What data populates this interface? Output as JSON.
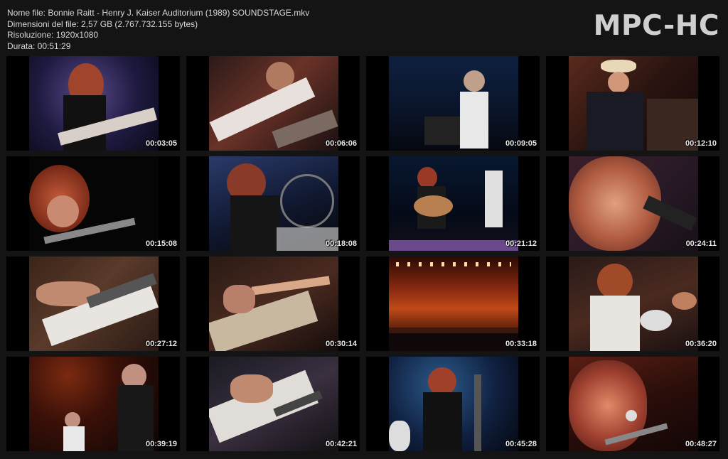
{
  "file_info": {
    "name_line": "Nome file: Bonnie Raitt - Henry J. Kaiser Auditorium (1989) SOUNDSTAGE.mkv",
    "size_line": "Dimensioni del file: 2,57 GB (2.767.732.155 bytes)",
    "resolution_line": "Risoluzione: 1920x1080",
    "duration_line": "Durata: 00:51:29"
  },
  "logo": "MPC-HC",
  "thumbnails": [
    {
      "time": "00:03:05"
    },
    {
      "time": "00:06:06"
    },
    {
      "time": "00:09:05"
    },
    {
      "time": "00:12:10"
    },
    {
      "time": "00:15:08"
    },
    {
      "time": "00:18:08"
    },
    {
      "time": "00:21:12"
    },
    {
      "time": "00:24:11"
    },
    {
      "time": "00:27:12"
    },
    {
      "time": "00:30:14"
    },
    {
      "time": "00:33:18"
    },
    {
      "time": "00:36:20"
    },
    {
      "time": "00:39:19"
    },
    {
      "time": "00:42:21"
    },
    {
      "time": "00:45:28"
    },
    {
      "time": "00:48:27"
    }
  ]
}
